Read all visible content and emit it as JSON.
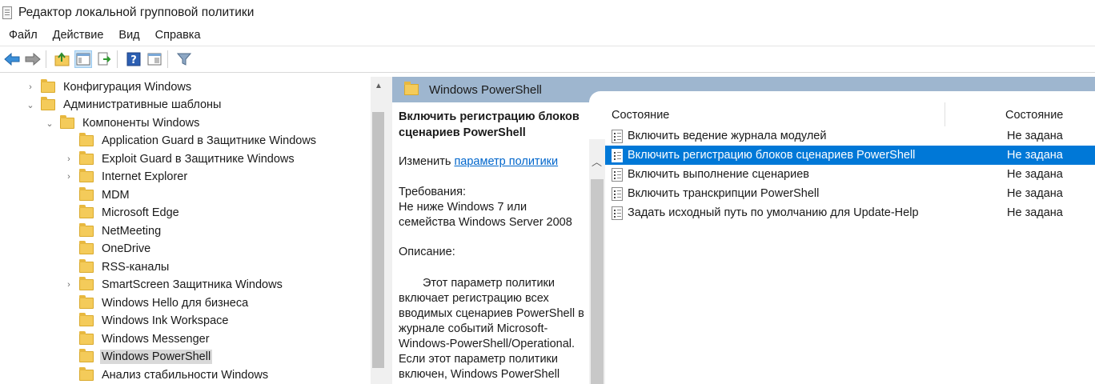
{
  "window": {
    "title": "Редактор локальной групповой политики"
  },
  "menu": [
    "Файл",
    "Действие",
    "Вид",
    "Справка"
  ],
  "toolbar": {
    "buttons": [
      "back-icon",
      "forward-icon",
      "up-folder-icon",
      "show-hide-tree-icon",
      "export-list-icon",
      "help-icon",
      "properties-icon",
      "filter-icon"
    ]
  },
  "tree": {
    "items": [
      {
        "label": "Конфигурация Windows",
        "chevron": "›",
        "level": 1
      },
      {
        "label": "Административные шаблоны",
        "chevron": "⌄",
        "level": 1
      },
      {
        "label": "Компоненты Windows",
        "chevron": "⌄",
        "level": 2
      },
      {
        "label": "Application Guard в Защитнике Windows",
        "chevron": "",
        "level": 3
      },
      {
        "label": "Exploit Guard в Защитнике Windows",
        "chevron": "›",
        "level": 3
      },
      {
        "label": "Internet Explorer",
        "chevron": "›",
        "level": 3
      },
      {
        "label": "MDM",
        "chevron": "",
        "level": 3
      },
      {
        "label": "Microsoft Edge",
        "chevron": "",
        "level": 3
      },
      {
        "label": "NetMeeting",
        "chevron": "",
        "level": 3
      },
      {
        "label": "OneDrive",
        "chevron": "",
        "level": 3
      },
      {
        "label": "RSS-каналы",
        "chevron": "",
        "level": 3
      },
      {
        "label": "SmartScreen Защитника Windows",
        "chevron": "›",
        "level": 3
      },
      {
        "label": "Windows Hello для бизнеса",
        "chevron": "",
        "level": 3
      },
      {
        "label": "Windows Ink Workspace",
        "chevron": "",
        "level": 3
      },
      {
        "label": "Windows Messenger",
        "chevron": "",
        "level": 3
      },
      {
        "label": "Windows PowerShell",
        "chevron": "",
        "level": 3,
        "selected": true
      },
      {
        "label": "Анализ стабильности Windows",
        "chevron": "",
        "level": 3
      }
    ]
  },
  "right": {
    "header": "Windows PowerShell",
    "description": {
      "title": "Включить регистрацию блоков сценариев PowerShell",
      "edit_prefix": "Изменить ",
      "edit_link": "параметр политики",
      "requirements_heading": "Требования:",
      "requirements": "Не ниже Windows 7 или семейства Windows Server 2008",
      "description_heading": "Описание:",
      "body": "Этот параметр политики включает регистрацию всех вводимых сценариев PowerShell в журнале событий Microsoft-Windows-PowerShell/Operational. Если этот параметр политики включен, Windows PowerShell"
    },
    "list": {
      "col_setting": "Состояние",
      "col_state": "Состояние",
      "rows": [
        {
          "name": "Включить ведение журнала модулей",
          "state": "Не задана"
        },
        {
          "name": "Включить регистрацию блоков сценариев PowerShell",
          "state": "Не задана",
          "selected": true
        },
        {
          "name": "Включить выполнение сценариев",
          "state": "Не задана"
        },
        {
          "name": "Включить транскрипции PowerShell",
          "state": "Не задана"
        },
        {
          "name": "Задать исходный путь по умолчанию для Update-Help",
          "state": "Не задана"
        }
      ]
    }
  },
  "colors": {
    "accent": "#0078d7",
    "header_bg": "#9eb6cf",
    "link": "#0066cc"
  }
}
